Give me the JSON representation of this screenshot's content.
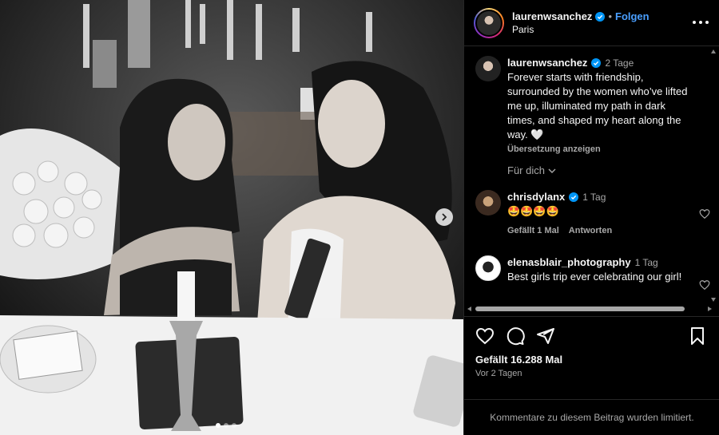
{
  "post": {
    "username": "laurenwsanchez",
    "follow_label": "Folgen",
    "location": "Paris",
    "separator": "•"
  },
  "caption": {
    "username": "laurenwsanchez",
    "time": "2 Tage",
    "text": "Forever starts with friendship, surrounded by the women who’ve lifted me up, illuminated my path in dark times, and shaped my heart along the way. 🤍",
    "translate_label": "Übersetzung anzeigen",
    "for_you_label": "Für dich"
  },
  "comments": [
    {
      "username": "chrisdylanx",
      "verified": true,
      "time": "1 Tag",
      "text": "🤩🤩🤩🤩",
      "likes_label": "Gefällt 1 Mal",
      "reply_label": "Antworten"
    },
    {
      "username": "elenasblair_photography",
      "verified": false,
      "time": "1 Tag",
      "text": "Best girls trip ever celebrating our girl!"
    }
  ],
  "actions": {
    "likes": "Gefällt 16.288 Mal",
    "posted_ago": "Vor 2 Tagen"
  },
  "footer": {
    "comments_limited": "Kommentare zu diesem Beitrag wurden limitiert."
  },
  "icons": [
    "verified-badge-icon",
    "more-options-icon",
    "heart-icon",
    "comment-icon",
    "share-icon",
    "save-icon",
    "chevron-down-icon",
    "chevron-right-icon"
  ],
  "colors": {
    "accent": "#4a9fff",
    "verified": "#0095f6",
    "muted": "#a8a8a8"
  }
}
